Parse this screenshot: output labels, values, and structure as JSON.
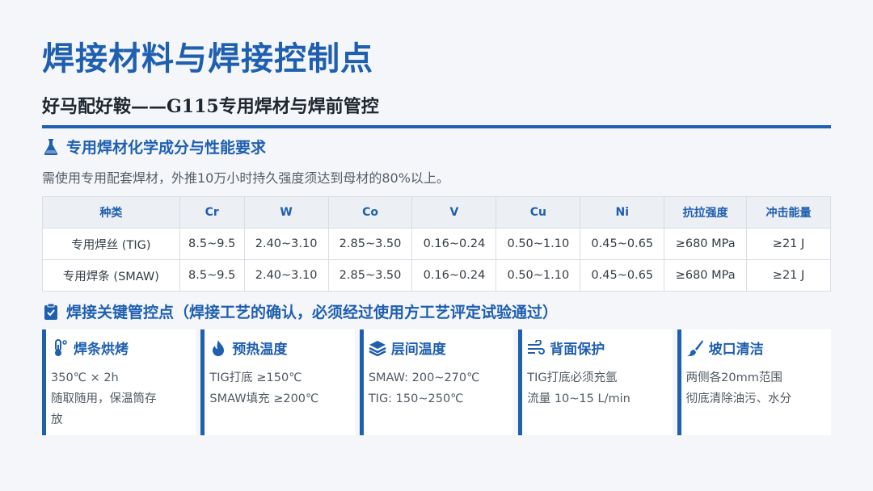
{
  "title": "焊接材料与焊接控制点",
  "subtitle": "好马配好鞍——G115专用焊材与焊前管控",
  "section1": {
    "heading": "专用焊材化学成分与性能要求",
    "icon": "flask-icon",
    "note": "需使用专用配套焊材，外推10万小时持久强度须达到母材的80%以上。"
  },
  "table": {
    "headers": [
      "种类",
      "Cr",
      "W",
      "Co",
      "V",
      "Cu",
      "Ni",
      "抗拉强度",
      "冲击能量"
    ],
    "rows": [
      [
        "专用焊丝 (TIG)",
        "8.5~9.5",
        "2.40~3.10",
        "2.85~3.50",
        "0.16~0.24",
        "0.50~1.10",
        "0.45~0.65",
        "≥680 MPa",
        "≥21 J"
      ],
      [
        "专用焊条 (SMAW)",
        "8.5~9.5",
        "2.40~3.10",
        "2.85~3.50",
        "0.16~0.24",
        "0.50~1.10",
        "0.45~0.65",
        "≥680 MPa",
        "≥21 J"
      ]
    ]
  },
  "section2": {
    "heading": "焊接关键管控点（焊接工艺的确认，必须经过使用方工艺评定试验通过）",
    "icon": "clipboard-check-icon"
  },
  "cards": [
    {
      "title": "焊条烘烤",
      "icon": "thermometer-icon",
      "lines": [
        "350℃ × 2h",
        "随取随用，保温筒存",
        "放"
      ]
    },
    {
      "title": "预热温度",
      "icon": "flame-icon",
      "lines": [
        "TIG打底 ≥150℃",
        "SMAW填充 ≥200℃"
      ]
    },
    {
      "title": "层间温度",
      "icon": "layers-icon",
      "lines": [
        "SMAW: 200~270℃",
        "TIG: 150~250℃"
      ]
    },
    {
      "title": "背面保护",
      "icon": "wind-icon",
      "lines": [
        "TIG打底必须充氩",
        "流量 10~15 L/min"
      ]
    },
    {
      "title": "坡口清洁",
      "icon": "brush-icon",
      "lines": [
        "两侧各20mm范围",
        "彻底清除油污、水分"
      ]
    }
  ],
  "colors": {
    "accent": "#1f5fb0",
    "background": "#f4f6f9"
  }
}
